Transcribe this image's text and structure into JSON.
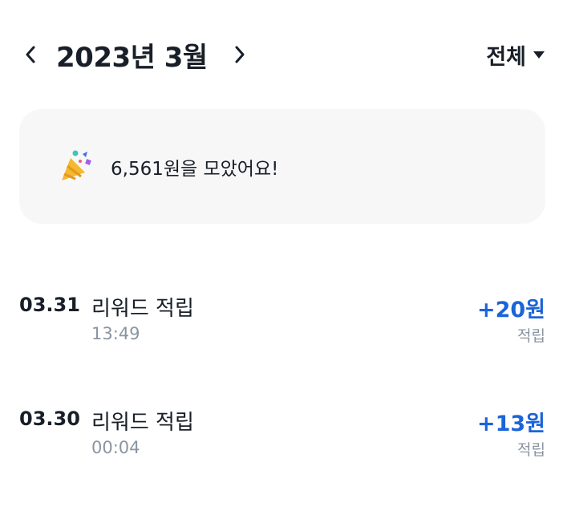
{
  "header": {
    "month_title": "2023년 3월",
    "filter_label": "전체",
    "prev_icon": "chevron-left-icon",
    "next_icon": "chevron-right-icon",
    "filter_icon": "caret-down-icon"
  },
  "summary": {
    "icon": "party-popper-icon",
    "text": "6,561원을 모았어요!"
  },
  "transactions": [
    {
      "date": "03.31",
      "title": "리워드 적립",
      "time": "13:49",
      "amount": "+20원",
      "type": "적립"
    },
    {
      "date": "03.30",
      "title": "리워드 적립",
      "time": "00:04",
      "amount": "+13원",
      "type": "적립"
    }
  ],
  "colors": {
    "amount": "#1b64da",
    "card_bg": "#f7f7f8",
    "secondary_text": "#8b95a1",
    "primary_text": "#191f28"
  }
}
